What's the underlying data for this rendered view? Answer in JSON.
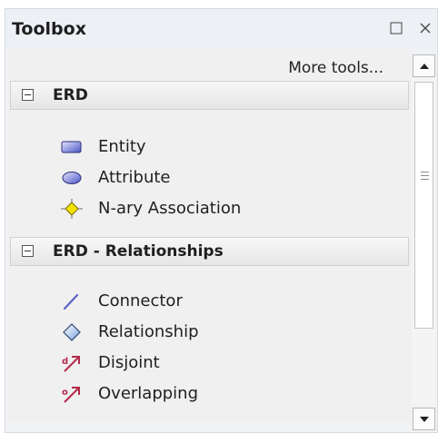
{
  "title": "Toolbox",
  "more_tools": "More tools...",
  "categories": [
    {
      "label": "ERD",
      "items": [
        {
          "label": "Entity",
          "icon": "entity-icon"
        },
        {
          "label": "Attribute",
          "icon": "attribute-icon"
        },
        {
          "label": "N-ary Association",
          "icon": "nary-association-icon"
        }
      ]
    },
    {
      "label": "ERD - Relationships",
      "items": [
        {
          "label": "Connector",
          "icon": "connector-icon"
        },
        {
          "label": "Relationship",
          "icon": "relationship-icon"
        },
        {
          "label": "Disjoint",
          "icon": "disjoint-icon"
        },
        {
          "label": "Overlapping",
          "icon": "overlapping-icon"
        }
      ]
    }
  ],
  "colors": {
    "entity_fill": "#5b63c9",
    "attribute_fill": "#5b63c9",
    "nary_fill": "#f4e300",
    "connector_stroke": "#5b63c9",
    "relationship_fill": "#a9c6ee",
    "disjoint_color": "#b52a4b"
  }
}
